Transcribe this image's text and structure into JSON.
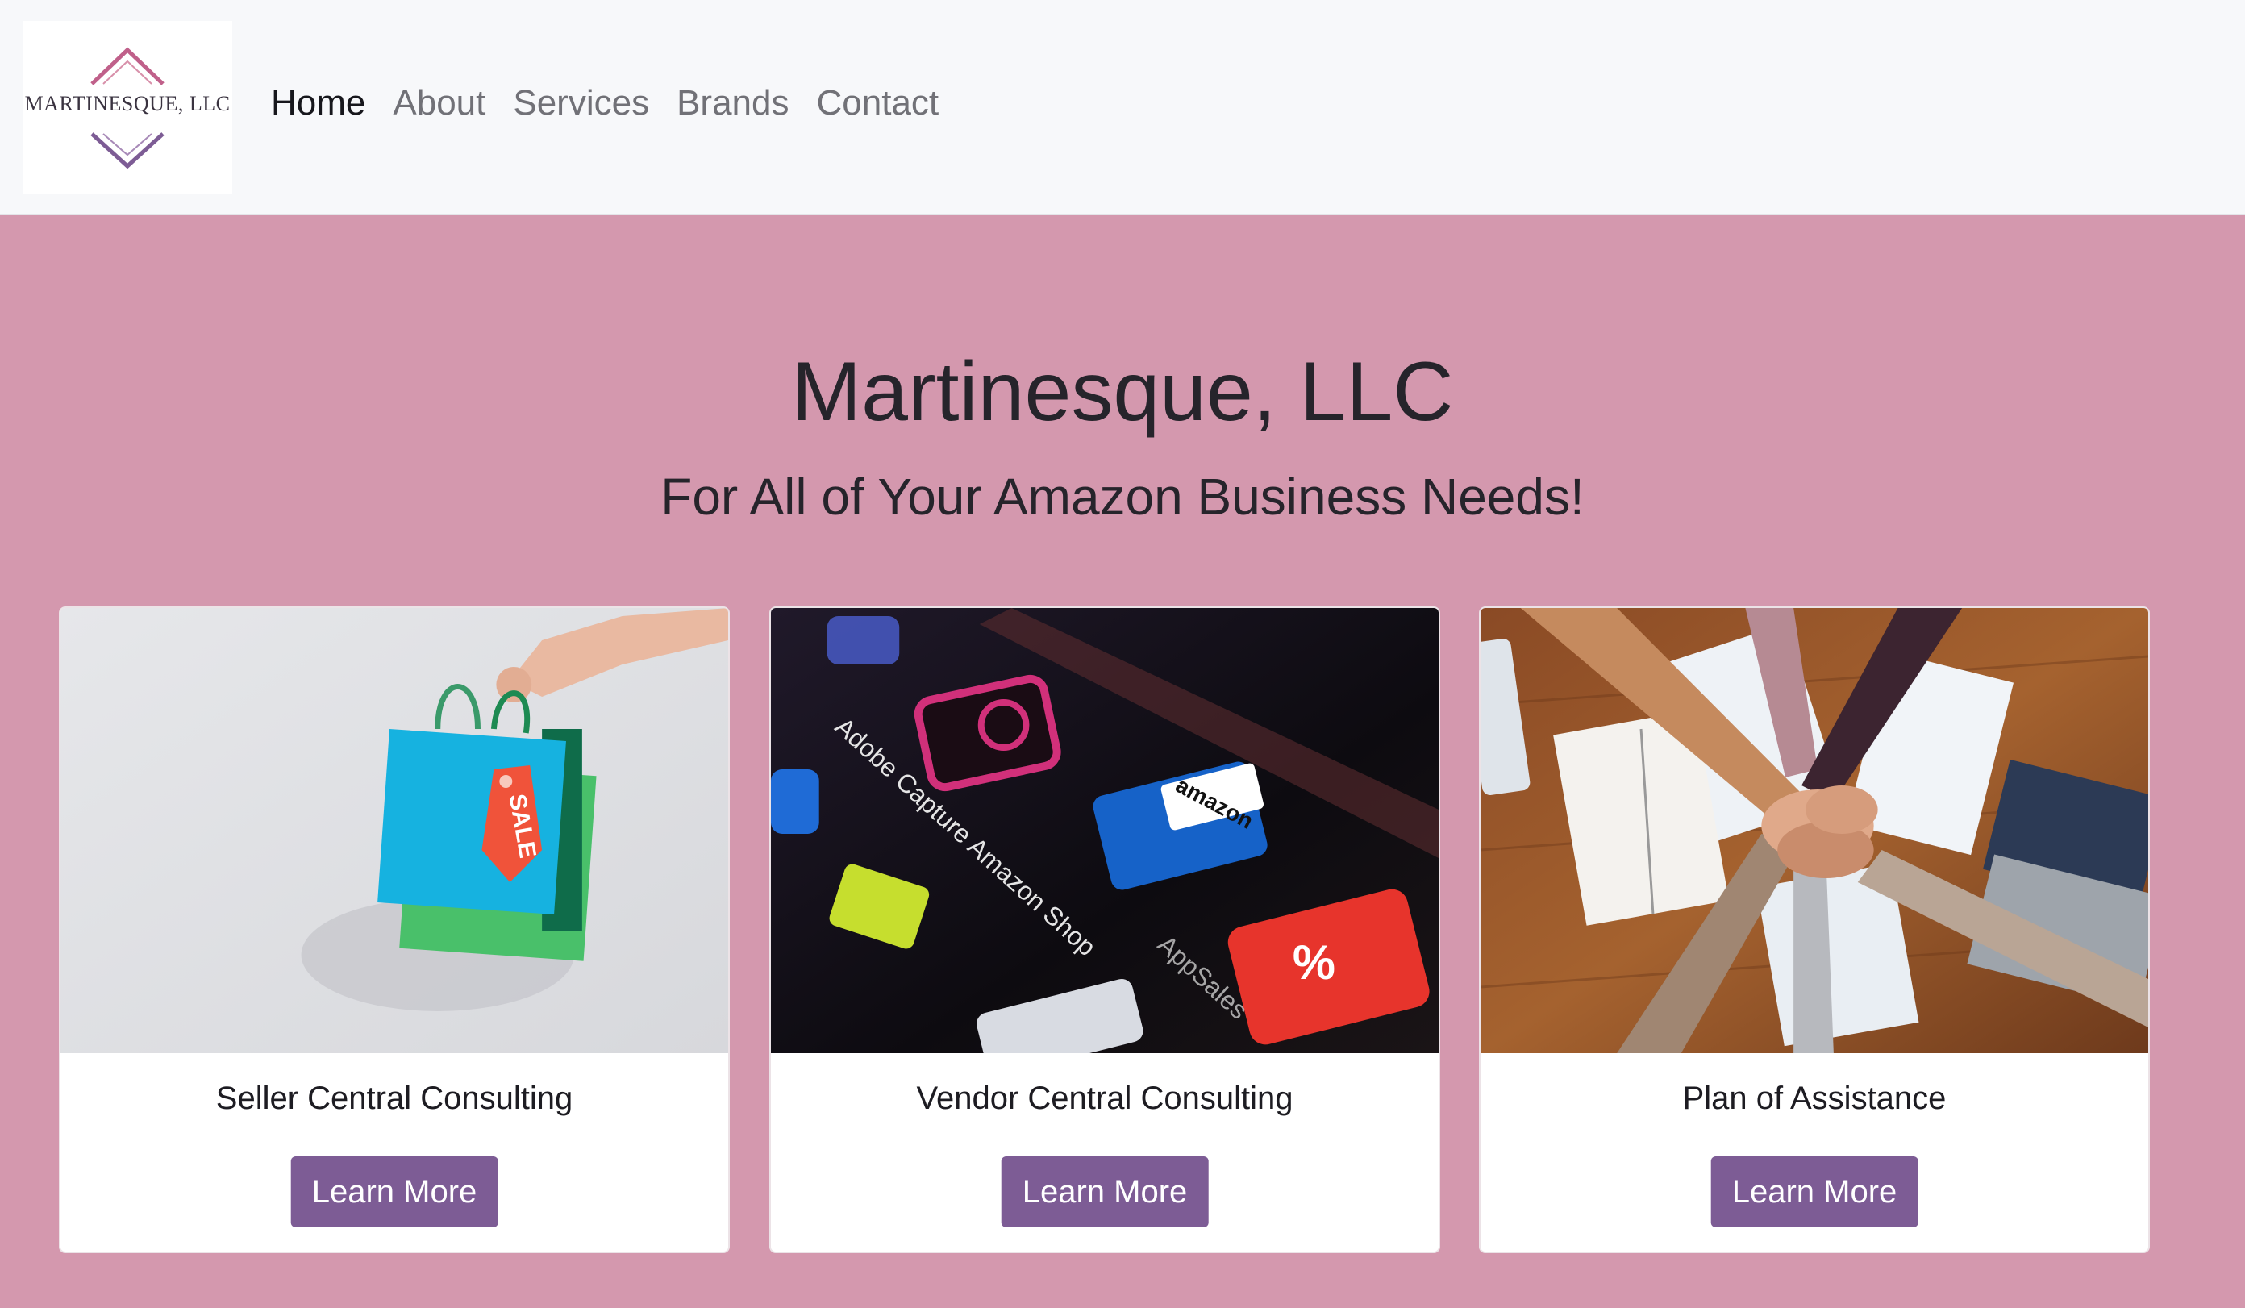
{
  "brand": {
    "logo_text": "MARTINESQUE, LLC",
    "colors": {
      "pink_background": "#d498ae",
      "button_purple": "#7d5c95",
      "navbar_background": "#f7f8fa"
    }
  },
  "nav": {
    "items": [
      {
        "label": "Home",
        "active": true
      },
      {
        "label": "About",
        "active": false
      },
      {
        "label": "Services",
        "active": false
      },
      {
        "label": "Brands",
        "active": false
      },
      {
        "label": "Contact",
        "active": false
      }
    ]
  },
  "hero": {
    "title": "Martinesque, LLC",
    "subtitle": "For All of Your Amazon Business Needs!"
  },
  "cards": [
    {
      "title": "Seller Central Consulting",
      "button_label": "Learn More",
      "image_icon": "shopping-bags-sale-image"
    },
    {
      "title": "Vendor Central Consulting",
      "button_label": "Learn More",
      "image_icon": "app-icons-amazon-screen-image"
    },
    {
      "title": "Plan of Assistance",
      "button_label": "Learn More",
      "image_icon": "team-hands-together-image"
    }
  ]
}
